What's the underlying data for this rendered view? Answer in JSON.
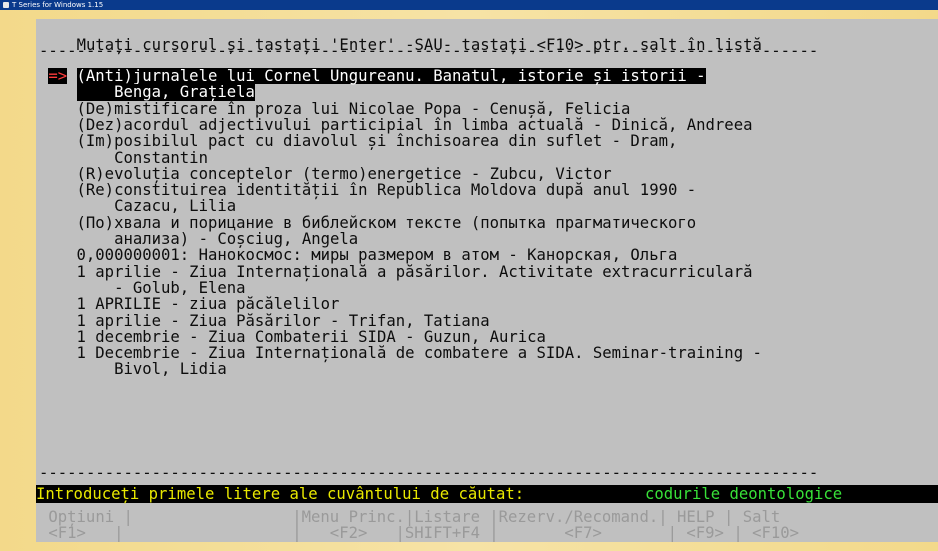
{
  "window": {
    "title": "T Series for Windows 1.15"
  },
  "instruction": "Mutați cursorul și tastați 'Enter' -SAU- tastați <F10> ptr. salt în listă",
  "separator": "-----------------------------------------------------------------------------------",
  "selection_marker": "=>",
  "list": [
    {
      "line1": "(Anti)jurnalele lui Cornel Ungureanu. Banatul, istorie și istorii -",
      "line2": "    Benga, Grațiela",
      "selected": true
    },
    {
      "line1": "(De)mistificare în proza lui Nicolae Popa - Cenușă, Felicia"
    },
    {
      "line1": "(Dez)acordul adjectivului participial în limba actuală - Dinică, Andreea"
    },
    {
      "line1": "(Im)posibilul pact cu diavolul și închisoarea din suflet - Dram,",
      "line2": "    Constantin"
    },
    {
      "line1": "(R)evoluția conceptelor (termo)energetice - Zubcu, Victor"
    },
    {
      "line1": "(Re)constituirea identității în Republica Moldova după anul 1990 -",
      "line2": "    Cazacu, Lilia"
    },
    {
      "line1": "(По)хвала и порицание в библейском тексте (попытка прагматического",
      "line2": "    анализа) - Coșciug, Angela"
    },
    {
      "line1": "0,000000001: Нанокосмос: миры размером в атом - Канорская, Ольга"
    },
    {
      "line1": "1 aprilie - Ziua Internațională a păsărilor. Activitate extracurriculară",
      "line2": "    - Golub, Elena"
    },
    {
      "line1": "1 APRILIE - ziua păcălelilor"
    },
    {
      "line1": "1 aprilie - Ziua Păsărilor - Trifan, Tatiana"
    },
    {
      "line1": "1 decembrie - Ziua Combaterii SIDA - Guzun, Aurica"
    },
    {
      "line1": "1 Decembrie - Ziua Internațională de combatere a SIDA. Seminar-training -",
      "line2": "    Bivol, Lidia"
    }
  ],
  "search": {
    "prompt": "Introduceți primele litere ale cuvântului de căutat:",
    "value": "codurile deontologice"
  },
  "function_keys": {
    "row1": [
      {
        "text": "Opțiuni |",
        "col": 1
      },
      {
        "text": "|Menu Princ.|Listare",
        "col": 27
      },
      {
        "text": "|Rezerv./Recomand.| HELP | Salt",
        "col": 48
      }
    ],
    "row2": [
      {
        "text": "<F1>   |",
        "col": 1
      },
      {
        "text": "|   <F2>   |SHIFT+F4",
        "col": 27
      },
      {
        "text": "|       <F7>       | <F9> | <F10>",
        "col": 48
      }
    ]
  },
  "colors": {
    "console_bg": "#c0c0c0",
    "title_bg": "#0a3a8c",
    "highlight_green": "#38e038",
    "prompt_yellow": "#e8e800",
    "marker_red": "#ff3b3b"
  }
}
